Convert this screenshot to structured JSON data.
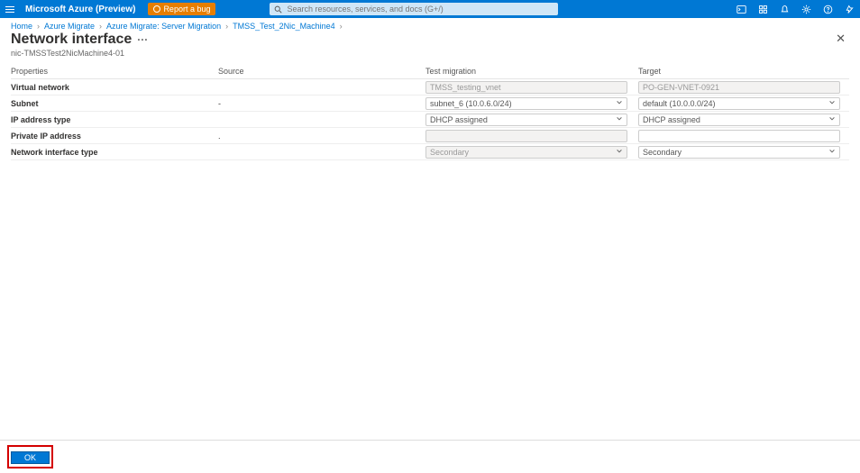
{
  "topbar": {
    "brand": "Microsoft Azure (Preview)",
    "bug": "Report a bug",
    "search_placeholder": "Search resources, services, and docs (G+/)"
  },
  "breadcrumb": [
    "Home",
    "Azure Migrate",
    "Azure Migrate: Server Migration",
    "TMSS_Test_2Nic_Machine4"
  ],
  "page": {
    "title": "Network interface",
    "subtitle": "nic-TMSSTest2NicMachine4-01"
  },
  "columns": {
    "props": "Properties",
    "source": "Source",
    "test": "Test migration",
    "target": "Target"
  },
  "rows": {
    "vnet": {
      "label": "Virtual network",
      "source": "",
      "test": "TMSS_testing_vnet",
      "test_ro": true,
      "target": "PO-GEN-VNET-0921",
      "target_ro": true
    },
    "subnet": {
      "label": "Subnet",
      "source": "-",
      "test": "subnet_6 (10.0.6.0/24)",
      "test_ro": false,
      "target": "default (10.0.0.0/24)",
      "target_ro": false
    },
    "iptype": {
      "label": "IP address type",
      "source": "",
      "test": "DHCP assigned",
      "test_ro": false,
      "target": "DHCP assigned",
      "target_ro": false
    },
    "pip": {
      "label": "Private IP address",
      "source": ".",
      "test": "",
      "test_ro": true,
      "target": "",
      "target_ro": false
    },
    "ntype": {
      "label": "Network interface type",
      "source": "",
      "test": "Secondary",
      "test_ro": true,
      "target": "Secondary",
      "target_ro": false
    }
  },
  "footer": {
    "ok": "OK"
  }
}
